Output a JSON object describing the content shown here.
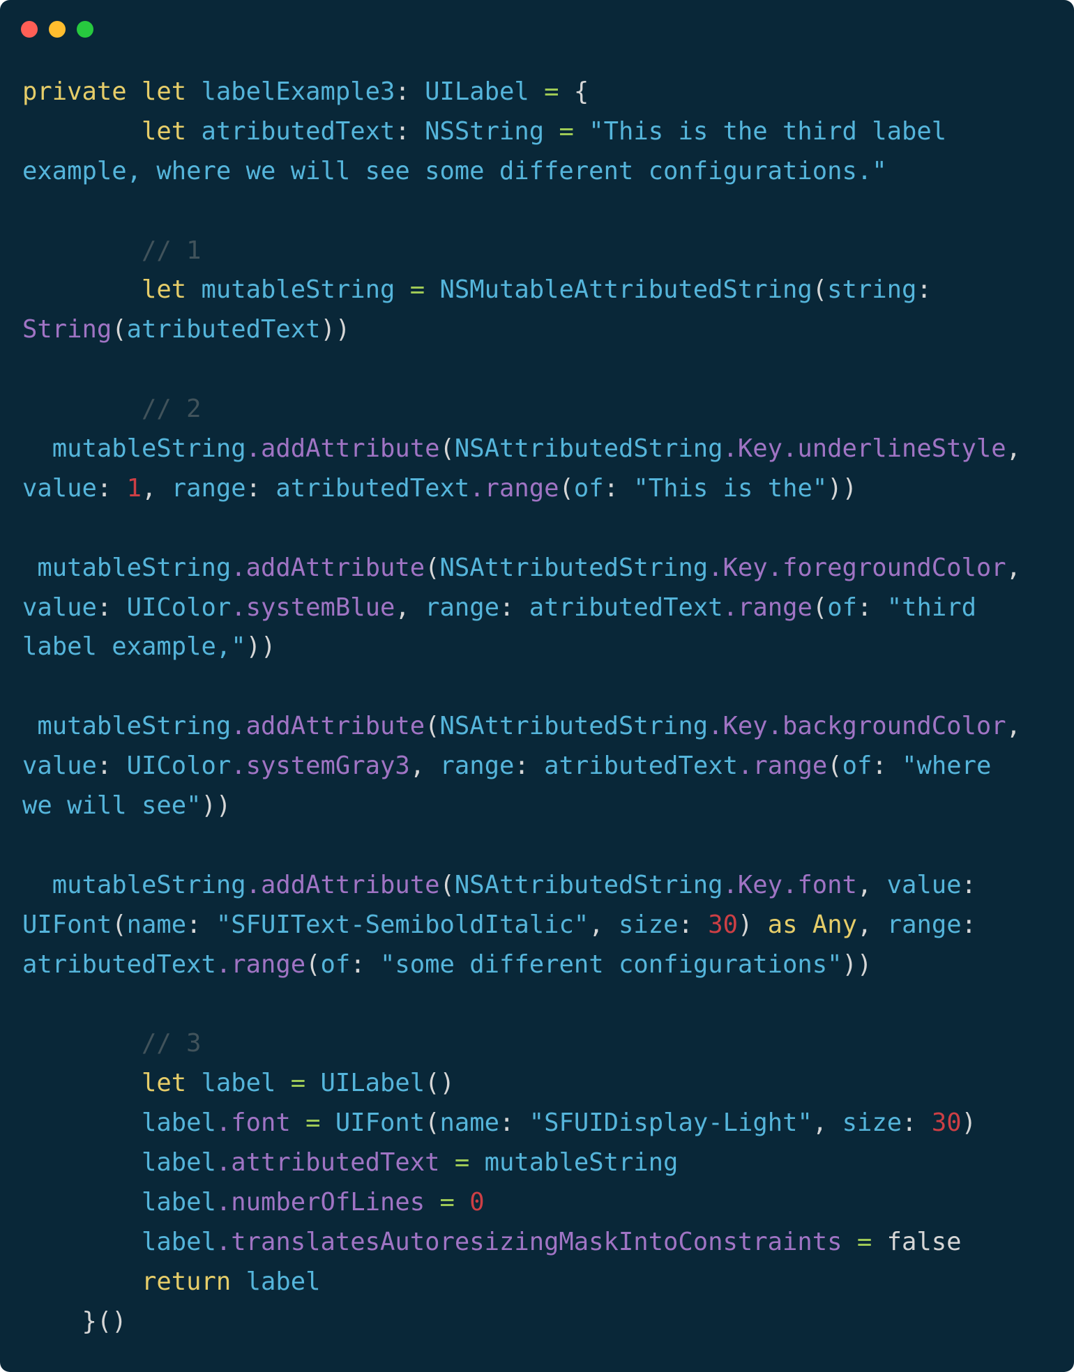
{
  "window": {
    "controls": [
      {
        "name": "close",
        "color": "#ff5f56"
      },
      {
        "name": "minimize",
        "color": "#ffbd2e"
      },
      {
        "name": "zoom",
        "color": "#27c93f"
      }
    ]
  },
  "colors": {
    "background": "#092738",
    "keyword": "#e6cd69",
    "identifier": "#55b5db",
    "member": "#a074c4",
    "number": "#cd3f45",
    "comment": "#41535b",
    "operator": "#9fca56",
    "punctuation": "#d6d6d6"
  },
  "code": {
    "lines": [
      [
        [
          "kw",
          "private"
        ],
        [
          "pun",
          " "
        ],
        [
          "kw",
          "let"
        ],
        [
          "pun",
          " "
        ],
        [
          "id",
          "labelExample3"
        ],
        [
          "pun",
          ": "
        ],
        [
          "id",
          "UILabel"
        ],
        [
          "pun",
          " "
        ],
        [
          "op",
          "="
        ],
        [
          "pun",
          " {"
        ]
      ],
      [
        [
          "pun",
          "        "
        ],
        [
          "kw",
          "let"
        ],
        [
          "pun",
          " "
        ],
        [
          "id",
          "atributedText"
        ],
        [
          "pun",
          ": "
        ],
        [
          "id",
          "NSString"
        ],
        [
          "pun",
          " "
        ],
        [
          "op",
          "="
        ],
        [
          "pun",
          " "
        ],
        [
          "id",
          "\"This is the third label"
        ]
      ],
      [
        [
          "id",
          "example, where we will see some different configurations.\""
        ]
      ],
      [],
      [
        [
          "pun",
          "        "
        ],
        [
          "cmt",
          "// 1"
        ]
      ],
      [
        [
          "pun",
          "        "
        ],
        [
          "kw",
          "let"
        ],
        [
          "pun",
          " "
        ],
        [
          "id",
          "mutableString"
        ],
        [
          "pun",
          " "
        ],
        [
          "op",
          "="
        ],
        [
          "pun",
          " "
        ],
        [
          "id",
          "NSMutableAttributedString"
        ],
        [
          "pun",
          "("
        ],
        [
          "id",
          "string"
        ],
        [
          "pun",
          ":"
        ]
      ],
      [
        [
          "mem",
          "String"
        ],
        [
          "pun",
          "("
        ],
        [
          "id",
          "atributedText"
        ],
        [
          "pun",
          "))"
        ]
      ],
      [],
      [
        [
          "pun",
          "        "
        ],
        [
          "cmt",
          "// 2"
        ]
      ],
      [
        [
          "pun",
          "  "
        ],
        [
          "id",
          "mutableString"
        ],
        [
          "mem",
          ".addAttribute"
        ],
        [
          "pun",
          "("
        ],
        [
          "id",
          "NSAttributedString"
        ],
        [
          "mem",
          ".Key.underlineStyle"
        ],
        [
          "pun",
          ","
        ]
      ],
      [
        [
          "id",
          "value"
        ],
        [
          "pun",
          ": "
        ],
        [
          "num",
          "1"
        ],
        [
          "pun",
          ", "
        ],
        [
          "id",
          "range"
        ],
        [
          "pun",
          ": "
        ],
        [
          "id",
          "atributedText"
        ],
        [
          "mem",
          ".range"
        ],
        [
          "pun",
          "("
        ],
        [
          "id",
          "of"
        ],
        [
          "pun",
          ": "
        ],
        [
          "id",
          "\"This is the\""
        ],
        [
          "pun",
          "))"
        ]
      ],
      [],
      [
        [
          "pun",
          " "
        ],
        [
          "id",
          "mutableString"
        ],
        [
          "mem",
          ".addAttribute"
        ],
        [
          "pun",
          "("
        ],
        [
          "id",
          "NSAttributedString"
        ],
        [
          "mem",
          ".Key.foregroundColor"
        ],
        [
          "pun",
          ","
        ]
      ],
      [
        [
          "id",
          "value"
        ],
        [
          "pun",
          ": "
        ],
        [
          "id",
          "UIColor"
        ],
        [
          "mem",
          ".systemBlue"
        ],
        [
          "pun",
          ", "
        ],
        [
          "id",
          "range"
        ],
        [
          "pun",
          ": "
        ],
        [
          "id",
          "atributedText"
        ],
        [
          "mem",
          ".range"
        ],
        [
          "pun",
          "("
        ],
        [
          "id",
          "of"
        ],
        [
          "pun",
          ": "
        ],
        [
          "id",
          "\"third"
        ]
      ],
      [
        [
          "id",
          "label example,\""
        ],
        [
          "pun",
          "))"
        ]
      ],
      [],
      [
        [
          "pun",
          " "
        ],
        [
          "id",
          "mutableString"
        ],
        [
          "mem",
          ".addAttribute"
        ],
        [
          "pun",
          "("
        ],
        [
          "id",
          "NSAttributedString"
        ],
        [
          "mem",
          ".Key.backgroundColor"
        ],
        [
          "pun",
          ","
        ]
      ],
      [
        [
          "id",
          "value"
        ],
        [
          "pun",
          ": "
        ],
        [
          "id",
          "UIColor"
        ],
        [
          "mem",
          ".systemGray3"
        ],
        [
          "pun",
          ", "
        ],
        [
          "id",
          "range"
        ],
        [
          "pun",
          ": "
        ],
        [
          "id",
          "atributedText"
        ],
        [
          "mem",
          ".range"
        ],
        [
          "pun",
          "("
        ],
        [
          "id",
          "of"
        ],
        [
          "pun",
          ": "
        ],
        [
          "id",
          "\"where"
        ]
      ],
      [
        [
          "id",
          "we will see\""
        ],
        [
          "pun",
          "))"
        ]
      ],
      [],
      [
        [
          "pun",
          "  "
        ],
        [
          "id",
          "mutableString"
        ],
        [
          "mem",
          ".addAttribute"
        ],
        [
          "pun",
          "("
        ],
        [
          "id",
          "NSAttributedString"
        ],
        [
          "mem",
          ".Key.font"
        ],
        [
          "pun",
          ", "
        ],
        [
          "id",
          "value"
        ],
        [
          "pun",
          ":"
        ]
      ],
      [
        [
          "id",
          "UIFont"
        ],
        [
          "pun",
          "("
        ],
        [
          "id",
          "name"
        ],
        [
          "pun",
          ": "
        ],
        [
          "id",
          "\"SFUIText-SemiboldItalic\""
        ],
        [
          "pun",
          ", "
        ],
        [
          "id",
          "size"
        ],
        [
          "pun",
          ": "
        ],
        [
          "num",
          "30"
        ],
        [
          "pun",
          ") "
        ],
        [
          "kw",
          "as"
        ],
        [
          "pun",
          " "
        ],
        [
          "kw",
          "Any"
        ],
        [
          "pun",
          ", "
        ],
        [
          "id",
          "range"
        ],
        [
          "pun",
          ":"
        ]
      ],
      [
        [
          "id",
          "atributedText"
        ],
        [
          "mem",
          ".range"
        ],
        [
          "pun",
          "("
        ],
        [
          "id",
          "of"
        ],
        [
          "pun",
          ": "
        ],
        [
          "id",
          "\"some different configurations\""
        ],
        [
          "pun",
          "))"
        ]
      ],
      [],
      [
        [
          "pun",
          "        "
        ],
        [
          "cmt",
          "// 3"
        ]
      ],
      [
        [
          "pun",
          "        "
        ],
        [
          "kw",
          "let"
        ],
        [
          "pun",
          " "
        ],
        [
          "id",
          "label"
        ],
        [
          "pun",
          " "
        ],
        [
          "op",
          "="
        ],
        [
          "pun",
          " "
        ],
        [
          "id",
          "UILabel"
        ],
        [
          "pun",
          "()"
        ]
      ],
      [
        [
          "pun",
          "        "
        ],
        [
          "id",
          "label"
        ],
        [
          "mem",
          ".font"
        ],
        [
          "pun",
          " "
        ],
        [
          "op",
          "="
        ],
        [
          "pun",
          " "
        ],
        [
          "id",
          "UIFont"
        ],
        [
          "pun",
          "("
        ],
        [
          "id",
          "name"
        ],
        [
          "pun",
          ": "
        ],
        [
          "id",
          "\"SFUIDisplay-Light\""
        ],
        [
          "pun",
          ", "
        ],
        [
          "id",
          "size"
        ],
        [
          "pun",
          ": "
        ],
        [
          "num",
          "30"
        ],
        [
          "pun",
          ")"
        ]
      ],
      [
        [
          "pun",
          "        "
        ],
        [
          "id",
          "label"
        ],
        [
          "mem",
          ".attributedText"
        ],
        [
          "pun",
          " "
        ],
        [
          "op",
          "="
        ],
        [
          "pun",
          " "
        ],
        [
          "id",
          "mutableString"
        ]
      ],
      [
        [
          "pun",
          "        "
        ],
        [
          "id",
          "label"
        ],
        [
          "mem",
          ".numberOfLines"
        ],
        [
          "pun",
          " "
        ],
        [
          "op",
          "="
        ],
        [
          "pun",
          " "
        ],
        [
          "num",
          "0"
        ]
      ],
      [
        [
          "pun",
          "        "
        ],
        [
          "id",
          "label"
        ],
        [
          "mem",
          ".translatesAutoresizingMaskIntoConstraints"
        ],
        [
          "pun",
          " "
        ],
        [
          "op",
          "="
        ],
        [
          "pun",
          " "
        ],
        [
          "lit",
          "false"
        ]
      ],
      [
        [
          "pun",
          "        "
        ],
        [
          "kw",
          "return"
        ],
        [
          "pun",
          " "
        ],
        [
          "id",
          "label"
        ]
      ],
      [
        [
          "pun",
          "    }()"
        ]
      ]
    ]
  }
}
